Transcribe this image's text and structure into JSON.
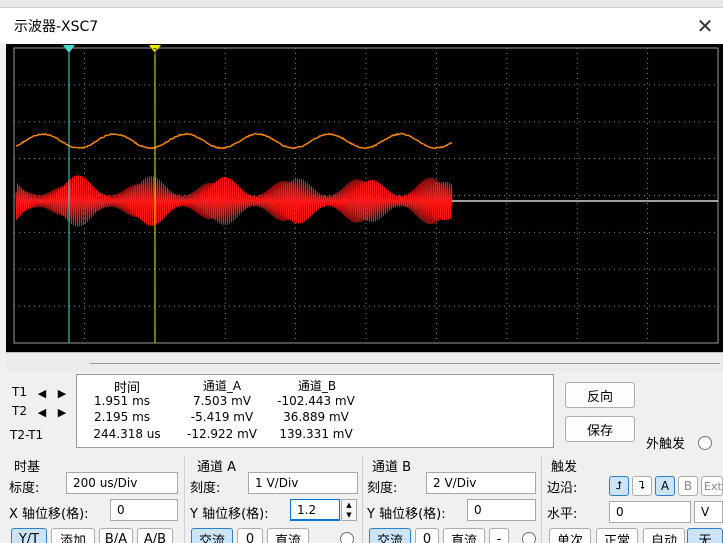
{
  "window": {
    "title": "示波器-XSC7",
    "close_glyph": "✕"
  },
  "colors": {
    "channel_a": "#ff8c00",
    "channel_b": "#ff1a1a",
    "cursor_1": "#40e0d0",
    "cursor_2": "#e8e800",
    "grid": "#8a8a8a",
    "background": "#000000"
  },
  "cursors": {
    "t1_marker": "1",
    "t2_marker": "2"
  },
  "readout": {
    "headers": [
      "时间",
      "通道_A",
      "通道_B"
    ],
    "rows": [
      {
        "label": "T1",
        "time": "1.951 ms",
        "a": "7.503 mV",
        "b": "-102.443 mV"
      },
      {
        "label": "T2",
        "time": "2.195 ms",
        "a": "-5.419 mV",
        "b": "36.889 mV"
      },
      {
        "label": "T2-T1",
        "time": "244.318 us",
        "a": "-12.922 mV",
        "b": "139.331 mV"
      }
    ]
  },
  "buttons": {
    "reverse": "反向",
    "save": "保存",
    "external_trigger": "外触发"
  },
  "timebase": {
    "title": "时基",
    "scale_label": "标度:",
    "scale": "200 us/Div",
    "xpos_label": "X 轴位移(格):",
    "xpos": "0",
    "modes": [
      "Y/T",
      "添加",
      "B/A",
      "A/B"
    ]
  },
  "channel_a": {
    "title": "通道 A",
    "scale_label": "刻度:",
    "scale": "1  V/Div",
    "ypos_label": "Y 轴位移(格):",
    "ypos": "1.2",
    "coupling": [
      "交流",
      "0",
      "直流"
    ]
  },
  "channel_b": {
    "title": "通道 B",
    "scale_label": "刻度:",
    "scale": "2  V/Div",
    "ypos_label": "Y 轴位移(格):",
    "ypos": "0",
    "coupling": [
      "交流",
      "0",
      "直流",
      "-"
    ]
  },
  "trigger": {
    "title": "触发",
    "edge_label": "边沿:",
    "edge_rise": "⮥",
    "edge_fall": "⮧",
    "sources": [
      "A",
      "B",
      "Ext"
    ],
    "level_label": "水平:",
    "level": "0",
    "level_unit": "V",
    "modes": [
      "单次",
      "正常",
      "自动",
      "无"
    ]
  }
}
